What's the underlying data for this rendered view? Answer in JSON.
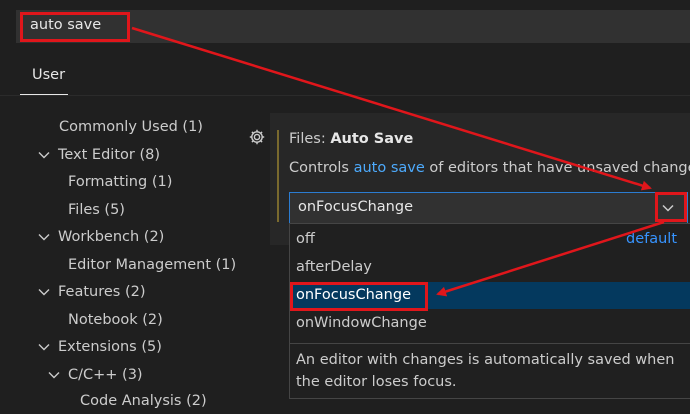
{
  "search": {
    "query": "auto save"
  },
  "tabs": [
    {
      "label": "User"
    }
  ],
  "toc": [
    {
      "label": "Commonly Used (1)",
      "expanded": null
    },
    {
      "label": "Text Editor (8)",
      "expanded": true
    },
    {
      "label": "Formatting (1)",
      "expanded": null
    },
    {
      "label": "Files (5)",
      "expanded": null
    },
    {
      "label": "Workbench (2)",
      "expanded": true
    },
    {
      "label": "Editor Management (1)",
      "expanded": null
    },
    {
      "label": "Features (2)",
      "expanded": true
    },
    {
      "label": "Notebook (2)",
      "expanded": null
    },
    {
      "label": "Extensions (5)",
      "expanded": true
    },
    {
      "label": "C/C++ (3)",
      "expanded": true
    },
    {
      "label": "Code Analysis (2)",
      "expanded": null
    }
  ],
  "setting": {
    "category": "Files: ",
    "name": "Auto Save",
    "desc_prefix": "Controls ",
    "desc_link": "auto save",
    "desc_suffix": " of editors that have unsaved changes",
    "value": "onFocusChange"
  },
  "dropdown": {
    "options": [
      {
        "label": "off",
        "note": "default"
      },
      {
        "label": "afterDelay"
      },
      {
        "label": "onFocusChange",
        "selected": true
      },
      {
        "label": "onWindowChange"
      }
    ],
    "description": "An editor with changes is automatically saved when the editor loses focus."
  },
  "colors": {
    "background": "#1f1f1f",
    "link": "#4daafc",
    "selected_option": "#04395e",
    "annotation_red": "#e0161b"
  }
}
